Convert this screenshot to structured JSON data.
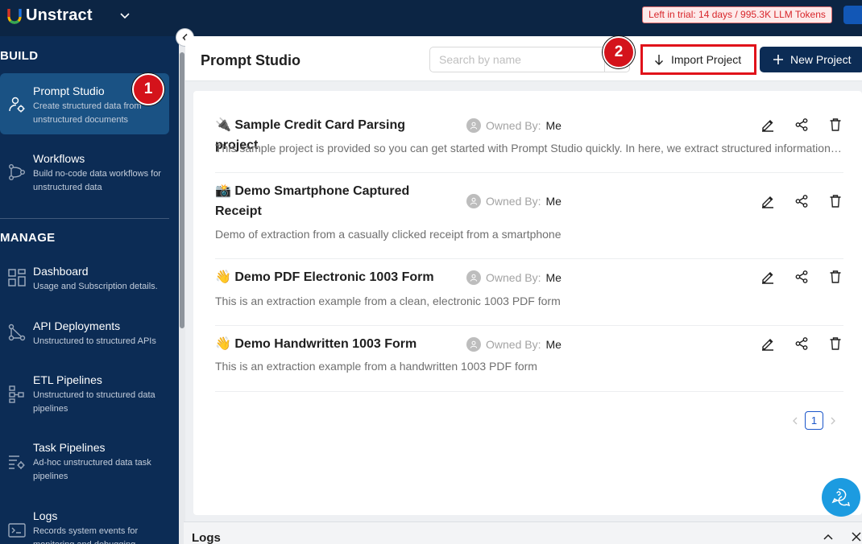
{
  "topbar": {
    "brand": "Unstract",
    "trial_text": "Left in trial: 14 days / 995.3K LLM Tokens"
  },
  "sidebar": {
    "build_title": "BUILD",
    "manage_title": "MANAGE",
    "build_items": [
      {
        "label": "Prompt Studio",
        "desc": "Create structured data from unstructured documents",
        "icon": "prompt-studio-icon",
        "active": true
      },
      {
        "label": "Workflows",
        "desc": "Build no-code data workflows for unstructured data",
        "icon": "workflow-icon",
        "active": false
      }
    ],
    "manage_items": [
      {
        "label": "Dashboard",
        "desc": "Usage and Subscription details.",
        "icon": "dashboard-icon"
      },
      {
        "label": "API Deployments",
        "desc": "Unstructured to structured APIs",
        "icon": "api-icon"
      },
      {
        "label": "ETL Pipelines",
        "desc": "Unstructured to structured data pipelines",
        "icon": "etl-icon"
      },
      {
        "label": "Task Pipelines",
        "desc": "Ad-hoc unstructured data task pipelines",
        "icon": "task-icon"
      },
      {
        "label": "Logs",
        "desc": "Records system events for monitoring and debugging",
        "icon": "terminal-icon"
      }
    ]
  },
  "header": {
    "title": "Prompt Studio",
    "search_placeholder": "Search by name",
    "import_label": "Import Project",
    "new_label": "New Project"
  },
  "projects": [
    {
      "emoji": "🔌",
      "title": "Sample Credit Card Parsing project",
      "owner_label": "Owned By:",
      "owner": "Me",
      "desc": "This sample project is provided so you can get started with Prompt Studio quickly. In here, we extract structured information from credit card statements."
    },
    {
      "emoji": "📸",
      "title": "Demo Smartphone Captured Receipt",
      "owner_label": "Owned By:",
      "owner": "Me",
      "desc": "Demo of extraction from a casually clicked receipt from a smartphone"
    },
    {
      "emoji": "👋",
      "title": "Demo PDF Electronic 1003 Form",
      "owner_label": "Owned By:",
      "owner": "Me",
      "desc": "This is an extraction example from a clean, electronic 1003 PDF form"
    },
    {
      "emoji": "👋",
      "title": "Demo Handwritten 1003 Form",
      "owner_label": "Owned By:",
      "owner": "Me",
      "desc": "This is an extraction example from a handwritten 1003 PDF form"
    }
  ],
  "pagination": {
    "current": "1"
  },
  "logs": {
    "title": "Logs"
  },
  "markers": {
    "one": "1",
    "two": "2"
  }
}
